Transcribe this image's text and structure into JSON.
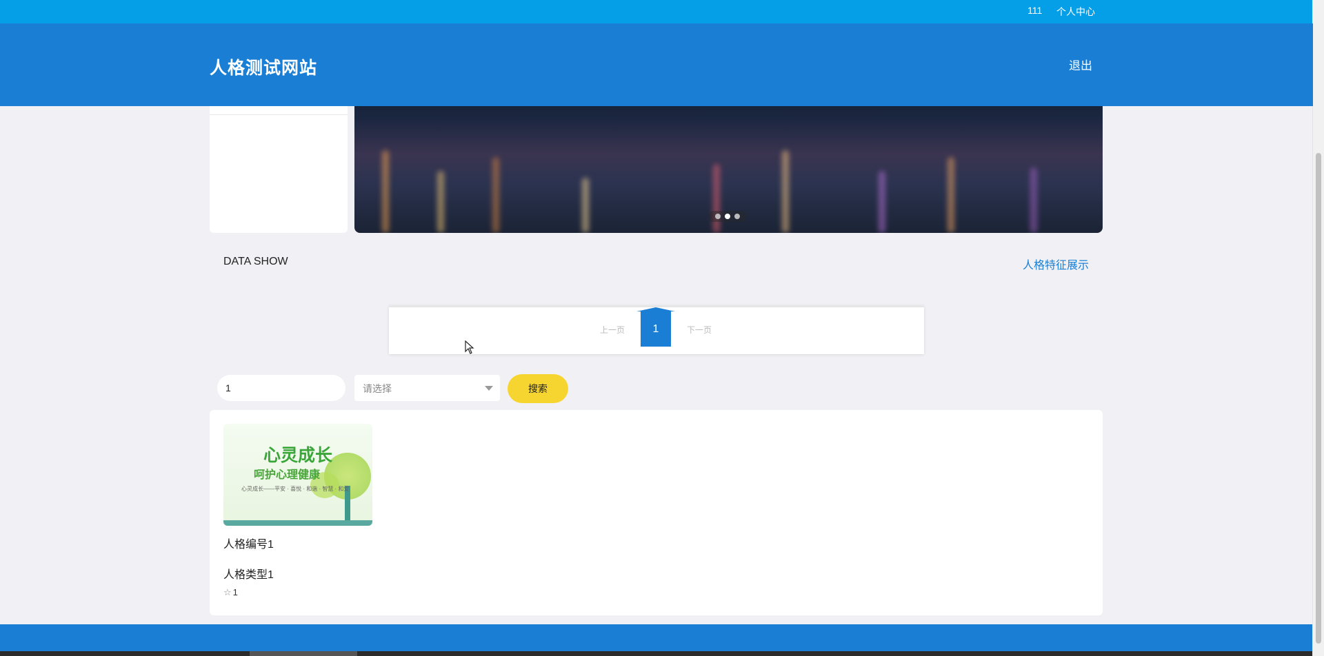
{
  "topbar": {
    "user": "111",
    "center_link": "个人中心"
  },
  "header": {
    "logo": "人格测试网站",
    "logout": "退出"
  },
  "banner": {
    "dots_count": 3,
    "active_dot": 2
  },
  "section": {
    "title": "DATA SHOW",
    "more_link": "人格特征展示"
  },
  "pager": {
    "prev": "上一页",
    "current": "1",
    "next": "下一页"
  },
  "search": {
    "keyword_value": "1",
    "select_placeholder": "请选择",
    "button": "搜索"
  },
  "items": [
    {
      "image_text_main": "心灵成长",
      "image_text_sub": "呵护心理健康",
      "image_text_small": "心灵成长——平安 · 喜悦 · 和谐 · 智慧 · 和爱",
      "name": "人格编号1",
      "type": "人格类型1",
      "stars": "1"
    }
  ],
  "colors": {
    "topbar": "#059fe8",
    "header": "#1a7fd4",
    "button": "#f7d530"
  }
}
